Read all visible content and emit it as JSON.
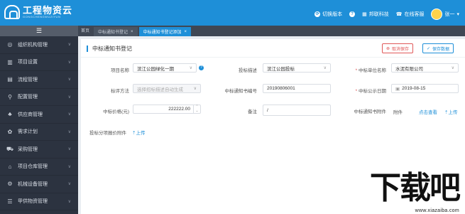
{
  "app": {
    "title": "工程物资云",
    "subtitle": "GONGCHENGWUZIYUN"
  },
  "topbar": {
    "items": [
      {
        "label": "切换版本",
        "icon": "switch-icon"
      },
      {
        "label": "",
        "icon": "help-icon"
      },
      {
        "label": "邦联科技",
        "icon": "company-icon"
      },
      {
        "label": "在线客服",
        "icon": "service-icon"
      }
    ],
    "user": "张一"
  },
  "sidebar": {
    "toggle": "☰",
    "items": [
      {
        "label": "组织机构管理",
        "icon": "org-icon"
      },
      {
        "label": "项目设置",
        "icon": "project-icon"
      },
      {
        "label": "流程管理",
        "icon": "flow-icon"
      },
      {
        "label": "配置管理",
        "icon": "config-icon"
      },
      {
        "label": "供应商管理",
        "icon": "supplier-icon"
      },
      {
        "label": "需求计划",
        "icon": "plan-icon"
      },
      {
        "label": "采购管理",
        "icon": "cart-icon"
      },
      {
        "label": "项目仓库管理",
        "icon": "warehouse-icon"
      },
      {
        "label": "机械设备管理",
        "icon": "machine-icon"
      },
      {
        "label": "甲供物资管理",
        "icon": "material-icon"
      }
    ]
  },
  "tabs": {
    "home": "首页",
    "items": [
      {
        "label": "中标通知书登记"
      },
      {
        "label": "中标通知书登记添加"
      }
    ]
  },
  "panel": {
    "title": "中标通知书登记",
    "cancel": "取消保存",
    "save": "保存数据"
  },
  "form": {
    "project_name": {
      "label": "项目名称",
      "value": "滨江公园绿化一期"
    },
    "bid_desc": {
      "label": "投标描述",
      "value": "滨江公园投标"
    },
    "winner": {
      "label": "中标单位名称",
      "value": "水泥有限公司"
    },
    "method": {
      "label": "标评方法",
      "placeholder": "选择招标描述自动生成"
    },
    "notice_no": {
      "label": "中标通知书编号",
      "value": "20190806001"
    },
    "publish_date": {
      "label": "中标公示日期",
      "value": "2019-08-15"
    },
    "price": {
      "label": "中标价格(元)",
      "value": "222222.00"
    },
    "remark": {
      "label": "备注",
      "value": "/"
    },
    "attachment": {
      "label": "中标通知书附件",
      "name": "附件",
      "view": "点击查看",
      "upload": "上传"
    },
    "split_attach": {
      "label": "投标分项报价附件",
      "upload": "上传"
    }
  },
  "watermark": {
    "big": "下载吧",
    "url": "www.xiazaiba.com"
  }
}
